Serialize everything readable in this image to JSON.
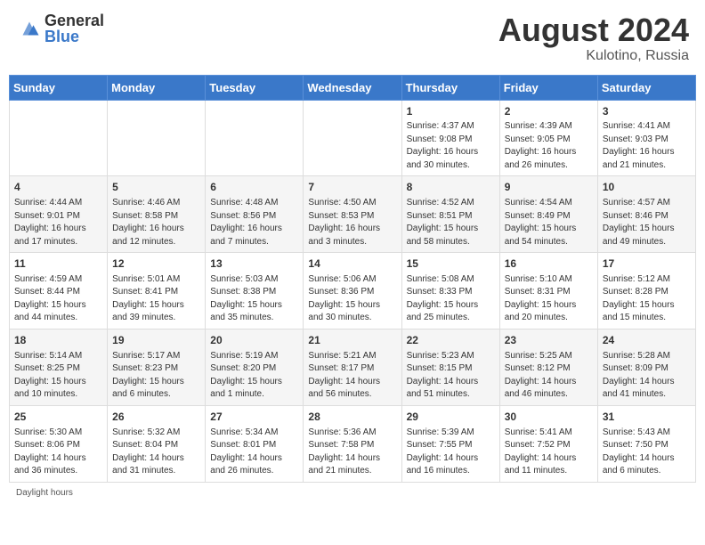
{
  "logo": {
    "general": "General",
    "blue": "Blue"
  },
  "title": {
    "month_year": "August 2024",
    "location": "Kulotino, Russia"
  },
  "days_of_week": [
    "Sunday",
    "Monday",
    "Tuesday",
    "Wednesday",
    "Thursday",
    "Friday",
    "Saturday"
  ],
  "footer": {
    "daylight_label": "Daylight hours"
  },
  "weeks": [
    [
      {
        "day": "",
        "sunrise": "",
        "sunset": "",
        "daylight": ""
      },
      {
        "day": "",
        "sunrise": "",
        "sunset": "",
        "daylight": ""
      },
      {
        "day": "",
        "sunrise": "",
        "sunset": "",
        "daylight": ""
      },
      {
        "day": "",
        "sunrise": "",
        "sunset": "",
        "daylight": ""
      },
      {
        "day": "1",
        "sunrise": "4:37 AM",
        "sunset": "9:08 PM",
        "daylight": "16 hours and 30 minutes."
      },
      {
        "day": "2",
        "sunrise": "4:39 AM",
        "sunset": "9:05 PM",
        "daylight": "16 hours and 26 minutes."
      },
      {
        "day": "3",
        "sunrise": "4:41 AM",
        "sunset": "9:03 PM",
        "daylight": "16 hours and 21 minutes."
      }
    ],
    [
      {
        "day": "4",
        "sunrise": "4:44 AM",
        "sunset": "9:01 PM",
        "daylight": "16 hours and 17 minutes."
      },
      {
        "day": "5",
        "sunrise": "4:46 AM",
        "sunset": "8:58 PM",
        "daylight": "16 hours and 12 minutes."
      },
      {
        "day": "6",
        "sunrise": "4:48 AM",
        "sunset": "8:56 PM",
        "daylight": "16 hours and 7 minutes."
      },
      {
        "day": "7",
        "sunrise": "4:50 AM",
        "sunset": "8:53 PM",
        "daylight": "16 hours and 3 minutes."
      },
      {
        "day": "8",
        "sunrise": "4:52 AM",
        "sunset": "8:51 PM",
        "daylight": "15 hours and 58 minutes."
      },
      {
        "day": "9",
        "sunrise": "4:54 AM",
        "sunset": "8:49 PM",
        "daylight": "15 hours and 54 minutes."
      },
      {
        "day": "10",
        "sunrise": "4:57 AM",
        "sunset": "8:46 PM",
        "daylight": "15 hours and 49 minutes."
      }
    ],
    [
      {
        "day": "11",
        "sunrise": "4:59 AM",
        "sunset": "8:44 PM",
        "daylight": "15 hours and 44 minutes."
      },
      {
        "day": "12",
        "sunrise": "5:01 AM",
        "sunset": "8:41 PM",
        "daylight": "15 hours and 39 minutes."
      },
      {
        "day": "13",
        "sunrise": "5:03 AM",
        "sunset": "8:38 PM",
        "daylight": "15 hours and 35 minutes."
      },
      {
        "day": "14",
        "sunrise": "5:06 AM",
        "sunset": "8:36 PM",
        "daylight": "15 hours and 30 minutes."
      },
      {
        "day": "15",
        "sunrise": "5:08 AM",
        "sunset": "8:33 PM",
        "daylight": "15 hours and 25 minutes."
      },
      {
        "day": "16",
        "sunrise": "5:10 AM",
        "sunset": "8:31 PM",
        "daylight": "15 hours and 20 minutes."
      },
      {
        "day": "17",
        "sunrise": "5:12 AM",
        "sunset": "8:28 PM",
        "daylight": "15 hours and 15 minutes."
      }
    ],
    [
      {
        "day": "18",
        "sunrise": "5:14 AM",
        "sunset": "8:25 PM",
        "daylight": "15 hours and 10 minutes."
      },
      {
        "day": "19",
        "sunrise": "5:17 AM",
        "sunset": "8:23 PM",
        "daylight": "15 hours and 6 minutes."
      },
      {
        "day": "20",
        "sunrise": "5:19 AM",
        "sunset": "8:20 PM",
        "daylight": "15 hours and 1 minute."
      },
      {
        "day": "21",
        "sunrise": "5:21 AM",
        "sunset": "8:17 PM",
        "daylight": "14 hours and 56 minutes."
      },
      {
        "day": "22",
        "sunrise": "5:23 AM",
        "sunset": "8:15 PM",
        "daylight": "14 hours and 51 minutes."
      },
      {
        "day": "23",
        "sunrise": "5:25 AM",
        "sunset": "8:12 PM",
        "daylight": "14 hours and 46 minutes."
      },
      {
        "day": "24",
        "sunrise": "5:28 AM",
        "sunset": "8:09 PM",
        "daylight": "14 hours and 41 minutes."
      }
    ],
    [
      {
        "day": "25",
        "sunrise": "5:30 AM",
        "sunset": "8:06 PM",
        "daylight": "14 hours and 36 minutes."
      },
      {
        "day": "26",
        "sunrise": "5:32 AM",
        "sunset": "8:04 PM",
        "daylight": "14 hours and 31 minutes."
      },
      {
        "day": "27",
        "sunrise": "5:34 AM",
        "sunset": "8:01 PM",
        "daylight": "14 hours and 26 minutes."
      },
      {
        "day": "28",
        "sunrise": "5:36 AM",
        "sunset": "7:58 PM",
        "daylight": "14 hours and 21 minutes."
      },
      {
        "day": "29",
        "sunrise": "5:39 AM",
        "sunset": "7:55 PM",
        "daylight": "14 hours and 16 minutes."
      },
      {
        "day": "30",
        "sunrise": "5:41 AM",
        "sunset": "7:52 PM",
        "daylight": "14 hours and 11 minutes."
      },
      {
        "day": "31",
        "sunrise": "5:43 AM",
        "sunset": "7:50 PM",
        "daylight": "14 hours and 6 minutes."
      }
    ]
  ]
}
